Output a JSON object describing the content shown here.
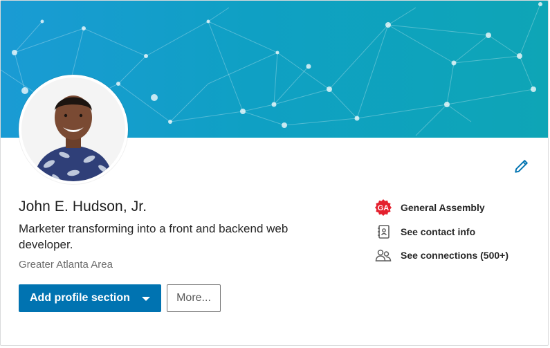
{
  "profile": {
    "name": "John E. Hudson, Jr.",
    "headline": "Marketer transforming into a front and backend web developer.",
    "location": "Greater Atlanta Area"
  },
  "actions": {
    "add_section_label": "Add profile section",
    "more_label": "More..."
  },
  "sidebar": {
    "items": [
      {
        "label": "General Assembly",
        "icon": "general-assembly-logo",
        "logo_text": "GA"
      },
      {
        "label": "See contact info",
        "icon": "contact-card-icon"
      },
      {
        "label": "See connections (500+)",
        "icon": "people-icon"
      }
    ]
  },
  "icons": {
    "edit": "pencil-icon"
  },
  "colors": {
    "primary_button": "#0073b1",
    "banner_start": "#1a9bd4",
    "banner_end": "#0ea5b6",
    "edit_icon": "#0073b1",
    "ga_logo": "#e4202e"
  }
}
